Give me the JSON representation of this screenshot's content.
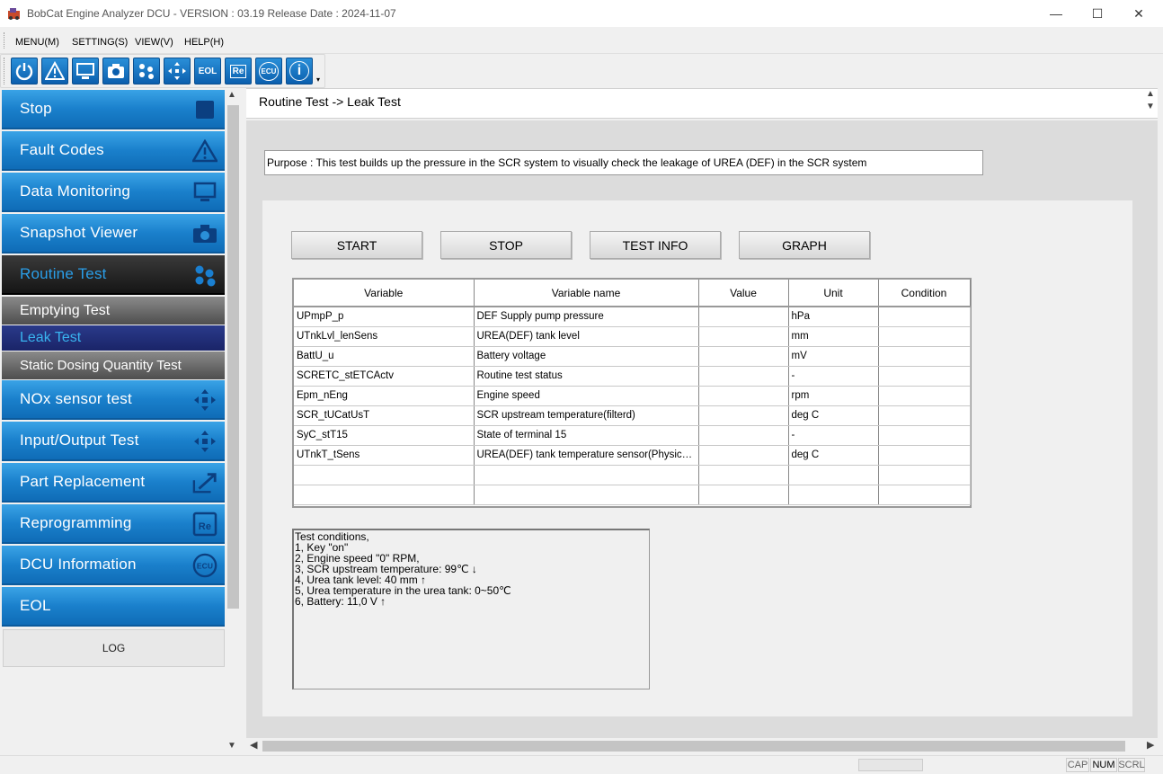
{
  "window": {
    "title": "BobCat Engine Analyzer DCU - VERSION : 03.19 Release Date : 2024-11-07",
    "minimize": "—",
    "maximize": "☐",
    "close": "✕"
  },
  "menu": [
    "MENU(M)",
    "SETTING(S)",
    "VIEW(V)",
    "HELP(H)"
  ],
  "toolbar": {
    "icons": [
      "power-icon",
      "warning-icon",
      "monitor-icon",
      "camera-icon",
      "routine-icon",
      "arrows-icon",
      "eol-icon",
      "re-icon",
      "ecu-icon",
      "info-icon"
    ],
    "eol_label": "EOL",
    "re_label": "Re",
    "ecu_label": "ECU",
    "info_label": "i"
  },
  "sidebar": {
    "items": [
      {
        "label": "Stop",
        "icon": "stop-icon"
      },
      {
        "label": "Fault Codes",
        "icon": "warning-icon"
      },
      {
        "label": "Data Monitoring",
        "icon": "monitor-icon"
      },
      {
        "label": "Snapshot Viewer",
        "icon": "camera-icon"
      },
      {
        "label": "Routine Test",
        "icon": "routine-icon"
      },
      {
        "label": "NOx sensor test",
        "icon": "arrows-icon"
      },
      {
        "label": "Input/Output Test",
        "icon": "arrows-icon"
      },
      {
        "label": "Part Replacement",
        "icon": "replace-icon"
      },
      {
        "label": "Reprogramming",
        "icon": "re-icon"
      },
      {
        "label": "DCU Information",
        "icon": "ecu-icon"
      },
      {
        "label": "EOL",
        "icon": ""
      }
    ],
    "subitems": [
      "Emptying Test",
      "Leak Test",
      "Static Dosing Quantity Test"
    ],
    "selected_sub": "Leak Test",
    "log_label": "LOG",
    "colors": {
      "accent": "#1a80cc",
      "dark": "#151515",
      "selected": "#1a2468"
    }
  },
  "main": {
    "breadcrumb": "Routine Test -> Leak Test",
    "purpose": "Purpose : This test builds up the pressure in the SCR system to visually check the leakage of UREA (DEF) in the SCR system",
    "buttons": {
      "start": "START",
      "stop": "STOP",
      "info": "TEST INFO",
      "graph": "GRAPH"
    },
    "table": {
      "headers": [
        "Variable",
        "Variable name",
        "Value",
        "Unit",
        "Condition"
      ],
      "rows": [
        [
          "UPmpP_p",
          "DEF Supply pump pressure",
          "",
          "hPa",
          ""
        ],
        [
          "UTnkLvl_lenSens",
          "UREA(DEF) tank level",
          "",
          "mm",
          ""
        ],
        [
          "BattU_u",
          "Battery voltage",
          "",
          "mV",
          ""
        ],
        [
          "SCRETC_stETCActv",
          "Routine test status",
          "",
          "-",
          ""
        ],
        [
          "Epm_nEng",
          "Engine speed",
          "",
          "rpm",
          ""
        ],
        [
          "SCR_tUCatUsT",
          "SCR upstream temperature(filterd)",
          "",
          "deg C",
          ""
        ],
        [
          "SyC_stT15",
          "State of terminal 15",
          "",
          "-",
          ""
        ],
        [
          "UTnkT_tSens",
          "UREA(DEF) tank temperature sensor(Physical...",
          "",
          "deg C",
          ""
        ],
        [
          "",
          "",
          "",
          "",
          ""
        ],
        [
          "",
          "",
          "",
          "",
          ""
        ]
      ]
    },
    "conditions": "Test conditions,\n1, Key \"on\"\n2, Engine speed \"0\" RPM,\n3, SCR upstream temperature: 99℃ ↓\n4, Urea tank level: 40 mm ↑\n5, Urea temperature in the urea tank: 0~50℃\n6, Battery: 11,0 V ↑"
  },
  "status": {
    "cap": "CAP",
    "num": "NUM",
    "scrl": "SCRL"
  }
}
